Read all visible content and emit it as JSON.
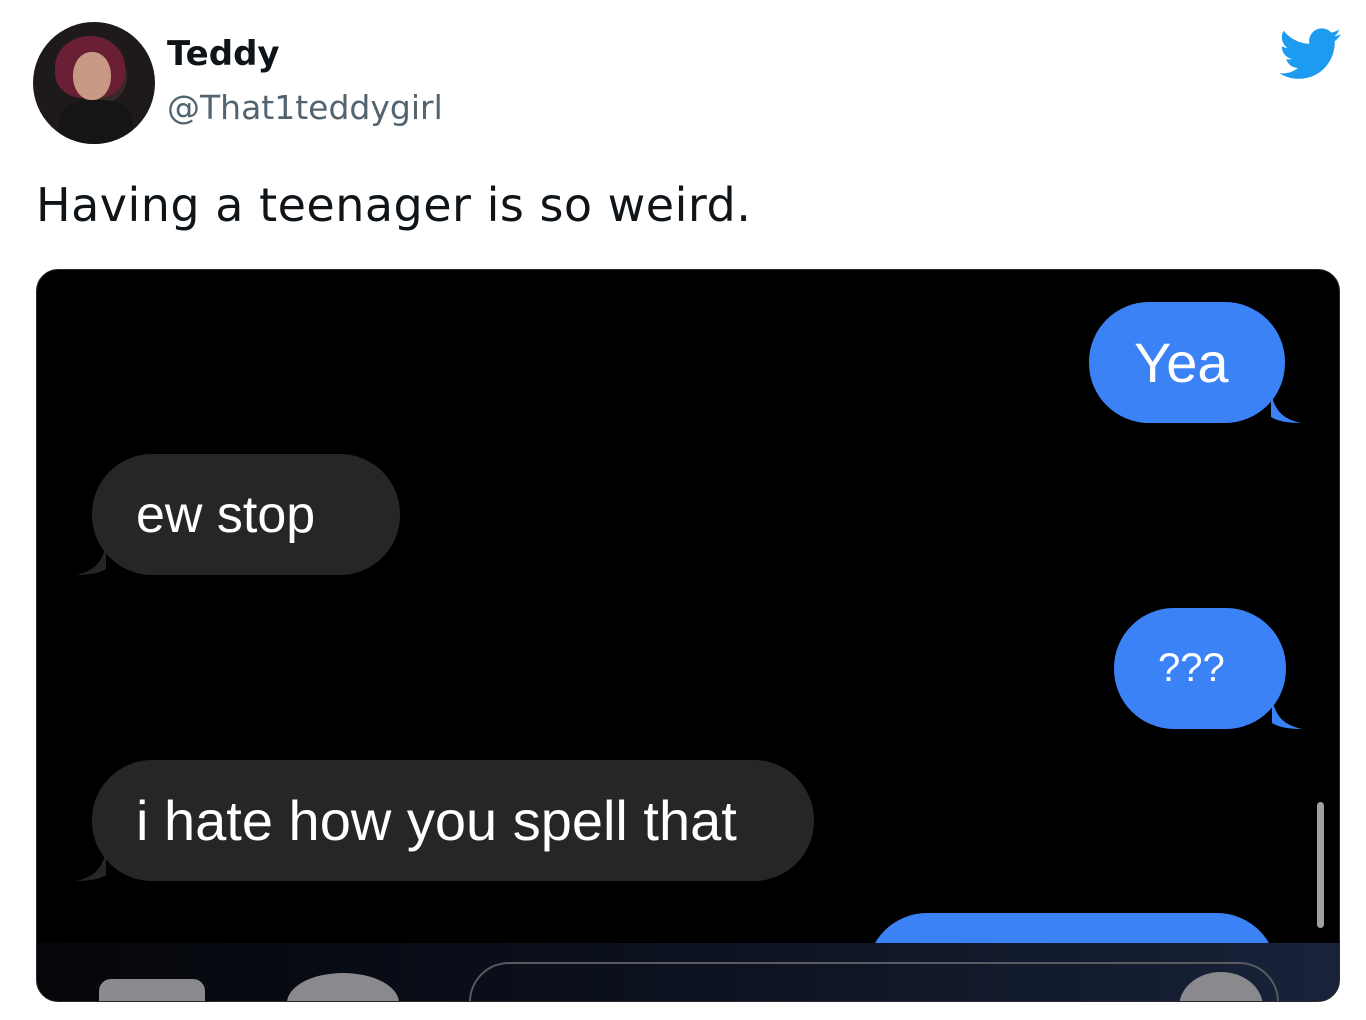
{
  "tweet": {
    "author_name": "Teddy",
    "author_handle": "@That1teddygirl",
    "text": "Having a teenager is so weird."
  },
  "conversation": {
    "messages": [
      {
        "direction": "sent",
        "text": "Yea"
      },
      {
        "direction": "received",
        "text": "ew stop"
      },
      {
        "direction": "sent",
        "text": "???"
      },
      {
        "direction": "received",
        "text": "i hate how you spell that"
      }
    ]
  },
  "colors": {
    "sent_bubble": "#3b82f6",
    "received_bubble": "#262629",
    "twitter_blue": "#1d9bf0"
  },
  "icons": [
    "twitter-bird-icon",
    "camera-icon",
    "app-store-icon",
    "microphone-icon"
  ]
}
